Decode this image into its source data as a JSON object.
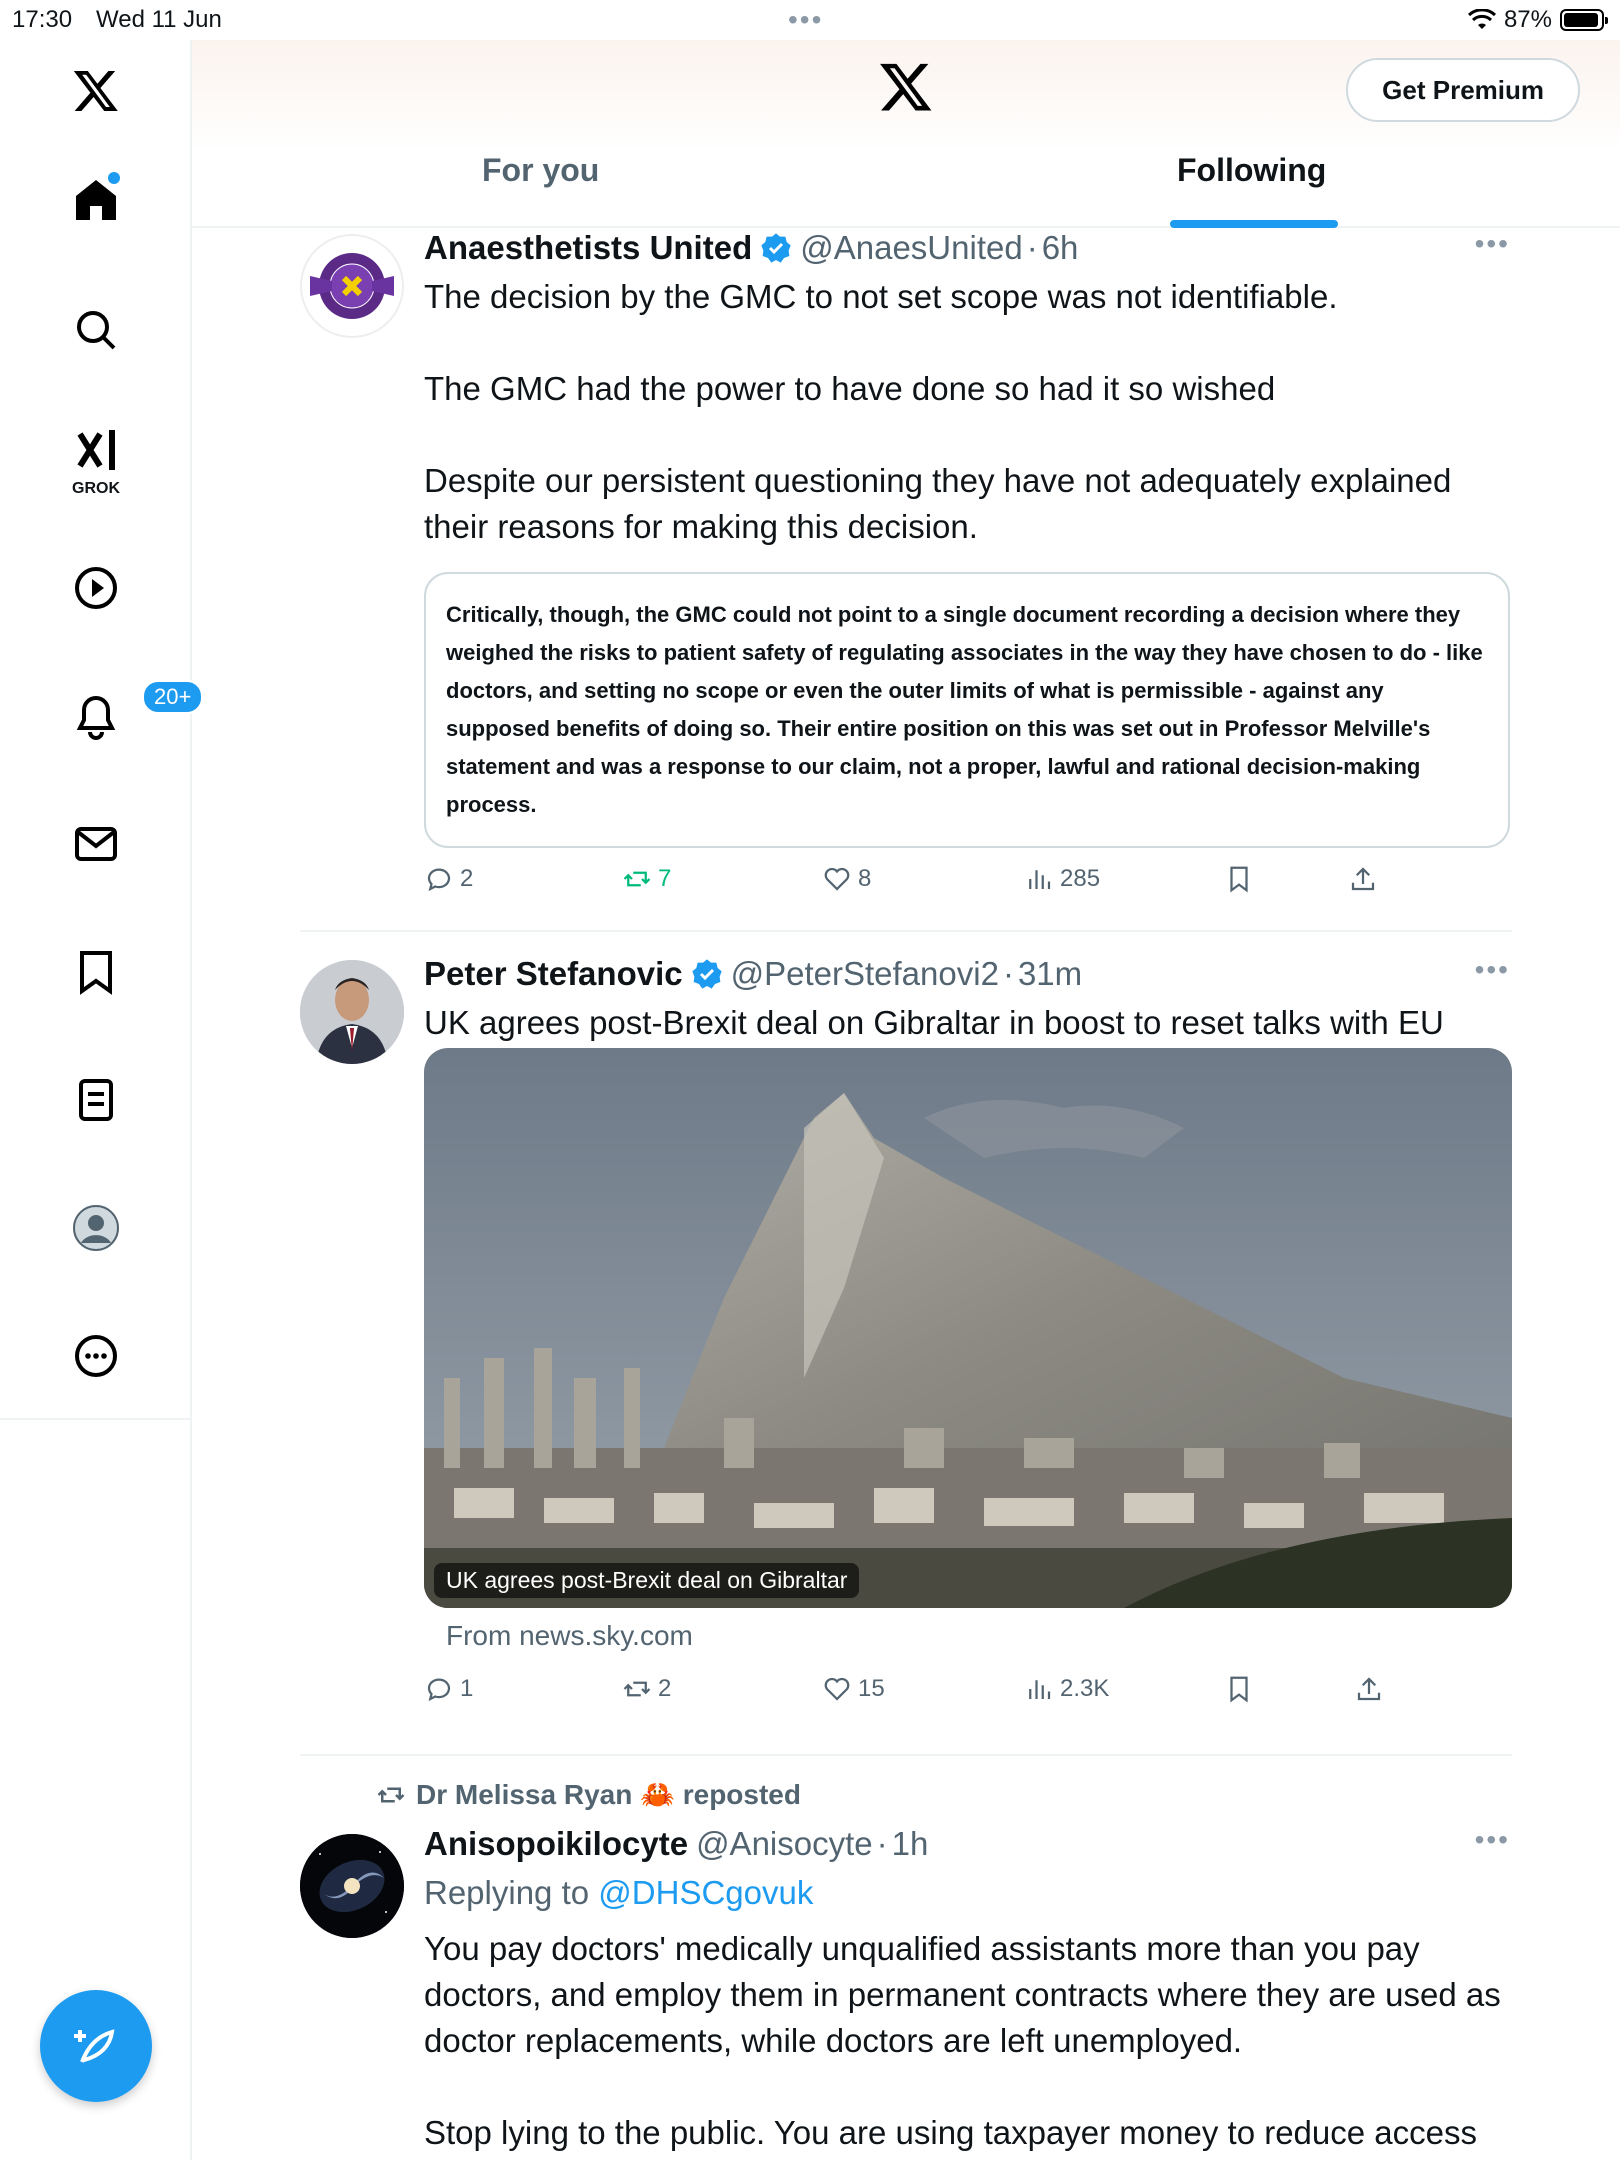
{
  "status_bar": {
    "time": "17:30",
    "date": "Wed 11 Jun",
    "battery": "87%"
  },
  "sidebar": {
    "notifications_badge": "20+",
    "grok_label": "GROK"
  },
  "header": {
    "premium_label": "Get Premium",
    "tabs": [
      {
        "label": "For you"
      },
      {
        "label": "Following"
      }
    ],
    "active_tab": "Following"
  },
  "tweets": [
    {
      "name": "Anaesthetists United",
      "handle": "@AnaesUnited",
      "time": "6h",
      "text": "The decision by the GMC to not set scope was not identifiable.\n\nThe GMC had the power to have done so had it so wished\n\nDespite our persistent questioning they have not adequately explained their reasons for making this decision.",
      "quote_text": "Critically, though, the GMC could not point to a single document recording a decision where they weighed the risks to patient safety of regulating associates in the way they have chosen to do - like doctors, and setting no scope or even the outer limits of what is permissible - against any supposed benefits of doing so. Their entire position on this was set out in Professor Melville's statement and was a response to our claim, not a proper, lawful and rational decision-making process.",
      "replies": "2",
      "reposts": "7",
      "likes": "8",
      "views": "285"
    },
    {
      "name": "Peter Stefanovic",
      "handle": "@PeterStefanovi2",
      "time": "31m",
      "text": "UK agrees post-Brexit deal on Gibraltar in boost to reset talks with EU",
      "media_caption": "UK agrees post-Brexit deal on Gibraltar",
      "link_source": "From news.sky.com",
      "replies": "1",
      "reposts": "2",
      "likes": "15",
      "views": "2.3K"
    },
    {
      "repost_label": "Dr Melissa Ryan 🦀 reposted",
      "name": "Anisopoikilocyte",
      "handle": "@Anisocyte",
      "time": "1h",
      "replying_prefix": "Replying to",
      "replying_to": "@DHSCgovuk",
      "text": "You pay doctors' medically unqualified assistants more than you pay doctors, and employ them in permanent contracts where they are used as doctor replacements, while doctors are left unemployed.\n\nStop lying to the public. You are using taxpayer money to reduce access"
    }
  ],
  "separator": "·",
  "colors": {
    "accent": "#1d9bf0",
    "repost_green": "#00ba7c",
    "secondary_text": "#536471"
  }
}
